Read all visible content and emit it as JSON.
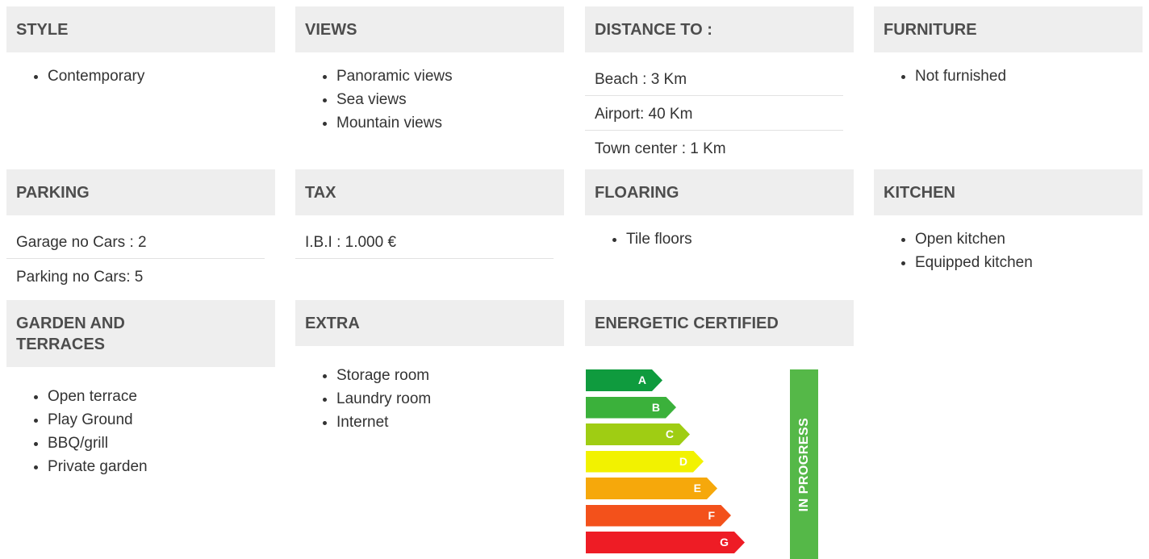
{
  "style": {
    "title": "STYLE",
    "items": [
      "Contemporary"
    ]
  },
  "views": {
    "title": "VIEWS",
    "items": [
      "Panoramic views",
      "Sea views",
      "Mountain views"
    ]
  },
  "distance": {
    "title": "DISTANCE TO :",
    "rows": [
      "Beach : 3 Km",
      "Airport: 40 Km",
      "Town center : 1 Km"
    ]
  },
  "furniture": {
    "title": "FURNITURE",
    "items": [
      "Not furnished"
    ]
  },
  "parking": {
    "title": "PARKING",
    "rows": [
      "Garage no Cars : 2",
      "Parking no Cars: 5"
    ]
  },
  "tax": {
    "title": "TAX",
    "rows": [
      "I.B.I : 1.000 €"
    ]
  },
  "flooring": {
    "title": "FLOARING",
    "items": [
      "Tile floors"
    ]
  },
  "kitchen": {
    "title": "KITCHEN",
    "items": [
      "Open kitchen",
      "Equipped kitchen"
    ]
  },
  "garden": {
    "title": "GARDEN AND TERRACES",
    "items": [
      "Open terrace",
      "Play Ground",
      "BBQ/grill",
      "Private garden"
    ]
  },
  "extra": {
    "title": "EXTRA",
    "items": [
      "Storage room",
      "Laundry room",
      "Internet"
    ]
  },
  "energy": {
    "title": "ENERGETIC CERTIFIED",
    "status": "IN PROGRESS",
    "status_color": "#55b848",
    "classes": [
      {
        "label": "A",
        "color": "#0f9b3e"
      },
      {
        "label": "B",
        "color": "#3bb13b"
      },
      {
        "label": "C",
        "color": "#9fcd13"
      },
      {
        "label": "D",
        "color": "#f2f200"
      },
      {
        "label": "E",
        "color": "#f6a80b"
      },
      {
        "label": "F",
        "color": "#f3511b"
      },
      {
        "label": "G",
        "color": "#ee1c25"
      }
    ]
  }
}
